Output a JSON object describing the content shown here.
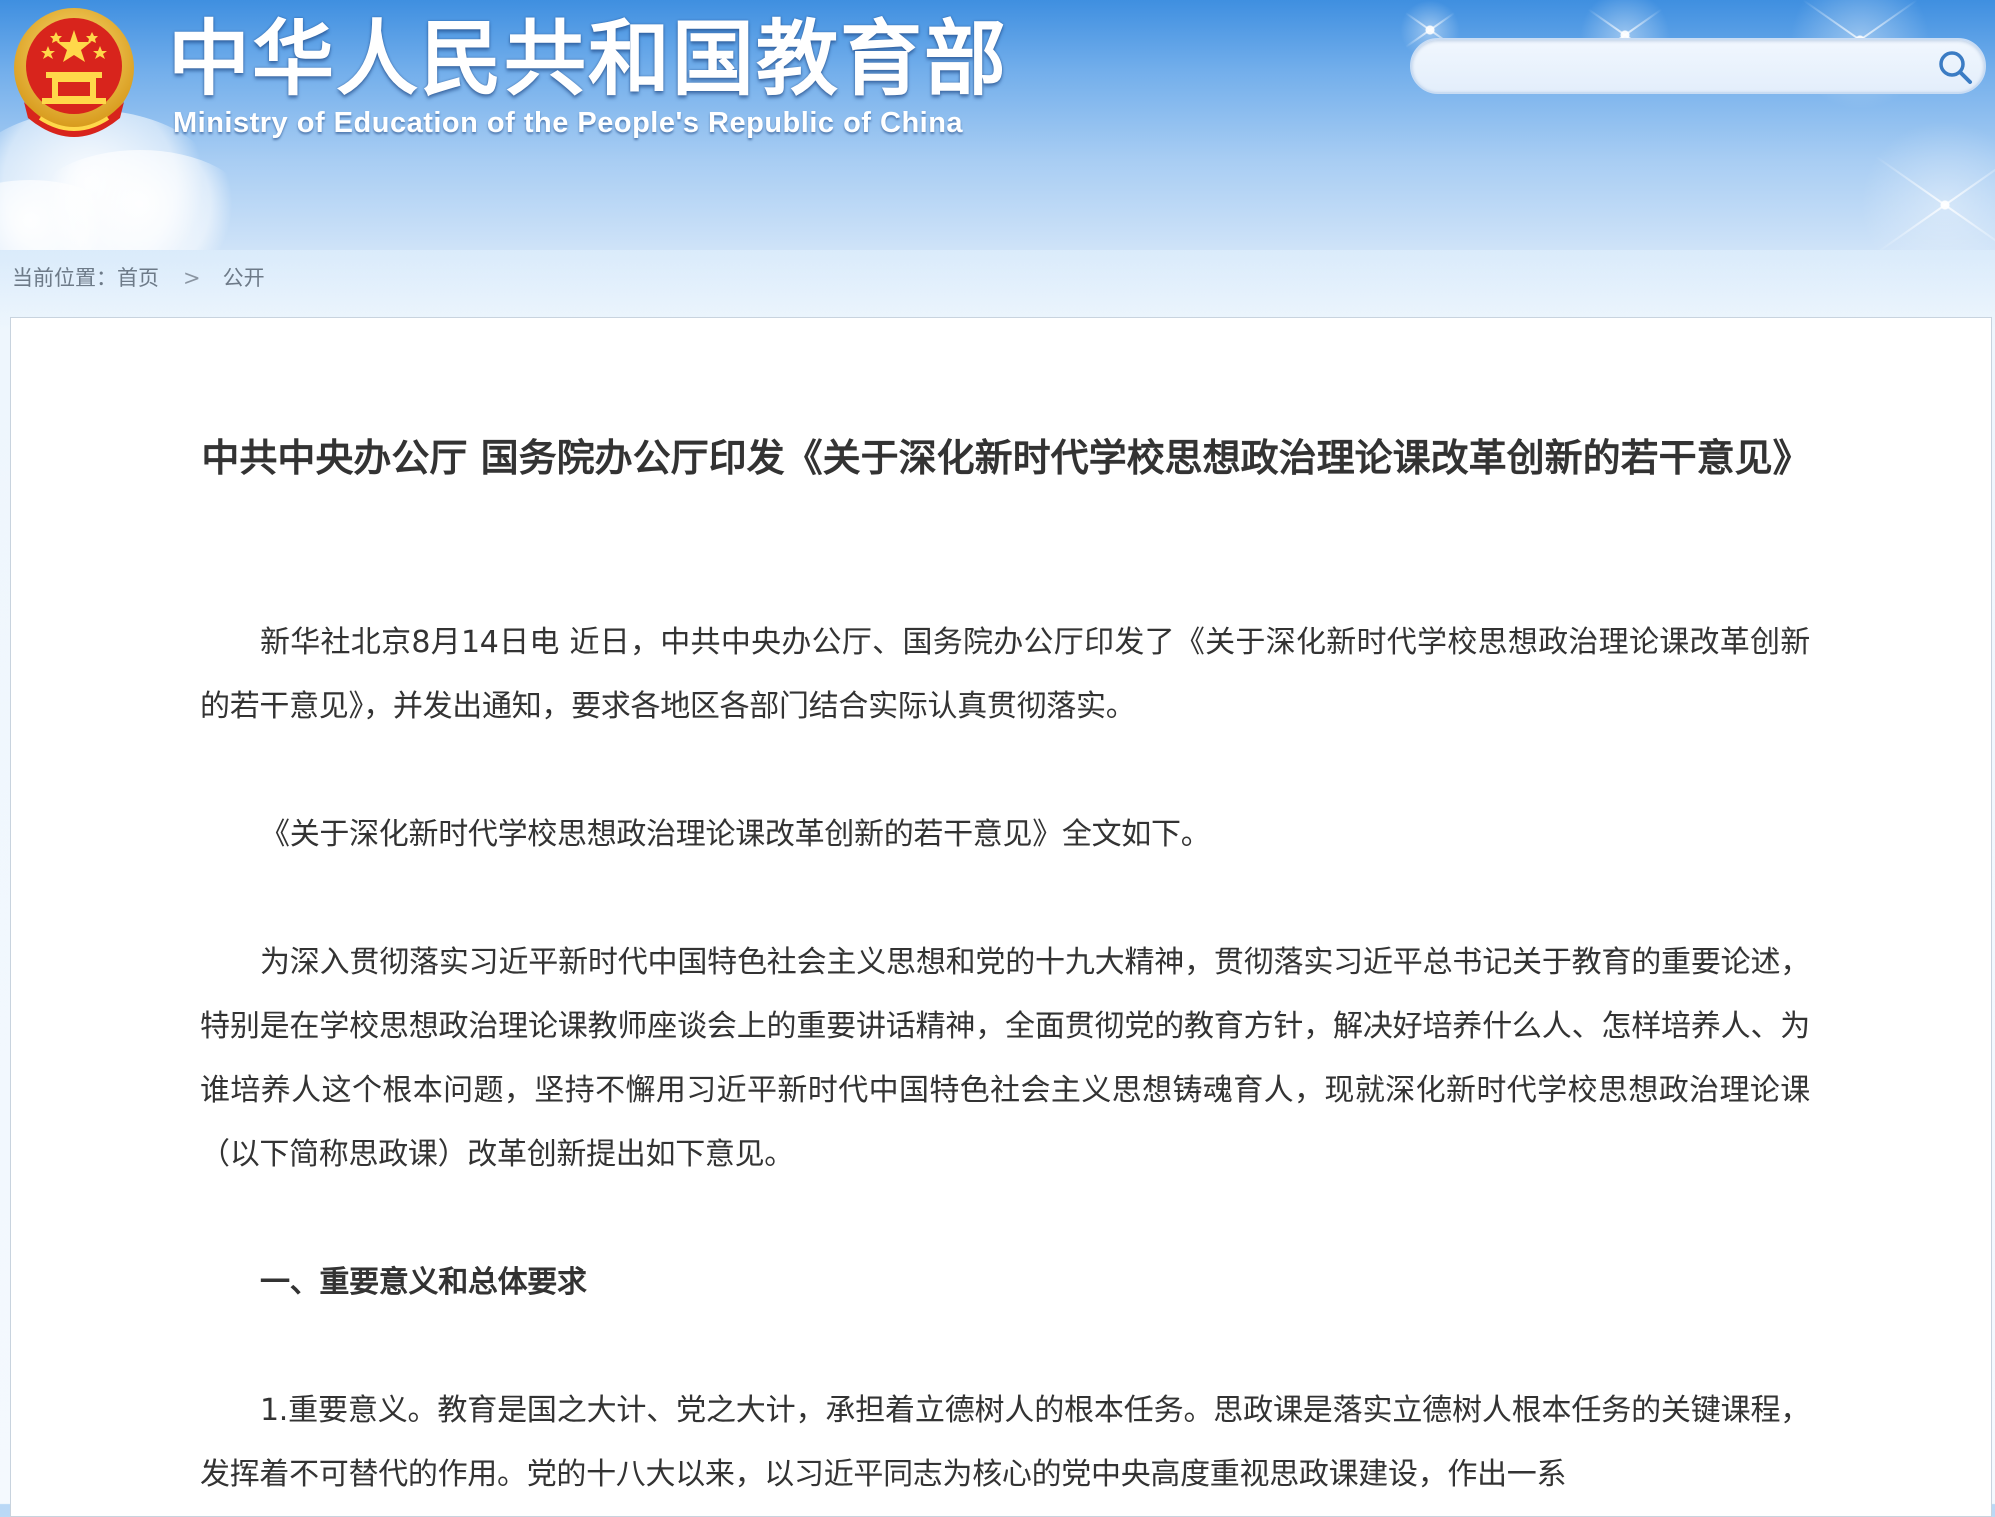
{
  "header": {
    "site_title_cn": "中华人民共和国教育部",
    "site_title_en": "Ministry of Education of the People's Republic of China",
    "search": {
      "value": "",
      "placeholder": ""
    }
  },
  "breadcrumb": {
    "prefix": "当前位置：",
    "items": [
      "首页",
      "公开"
    ],
    "separator": ">"
  },
  "article": {
    "title": "中共中央办公厅 国务院办公厅印发《关于深化新时代学校思想政治理论课改革创新的若干意见》",
    "paragraphs": [
      "新华社北京8月14日电 近日，中共中央办公厅、国务院办公厅印发了《关于深化新时代学校思想政治理论课改革创新的若干意见》，并发出通知，要求各地区各部门结合实际认真贯彻落实。",
      "《关于深化新时代学校思想政治理论课改革创新的若干意见》全文如下。",
      "为深入贯彻落实习近平新时代中国特色社会主义思想和党的十九大精神，贯彻落实习近平总书记关于教育的重要论述，特别是在学校思想政治理论课教师座谈会上的重要讲话精神，全面贯彻党的教育方针，解决好培养什么人、怎样培养人、为谁培养人这个根本问题，坚持不懈用习近平新时代中国特色社会主义思想铸魂育人，现就深化新时代学校思想政治理论课（以下简称思政课）改革创新提出如下意见。",
      "一、重要意义和总体要求",
      "1.重要意义。教育是国之大计、党之大计，承担着立德树人的根本任务。思政课是落实立德树人根本任务的关键课程，发挥着不可替代的作用。党的十八大以来，以习近平同志为核心的党中央高度重视思政课建设，作出一系"
    ]
  },
  "colors": {
    "header_blue": "#3f8fe0",
    "text": "#333333",
    "breadcrumb": "#6d7a88",
    "emblem_red": "#d8241c",
    "emblem_gold": "#f3c43f"
  },
  "icons": [
    "national-emblem-icon",
    "search-icon",
    "chevron-right-icon"
  ]
}
